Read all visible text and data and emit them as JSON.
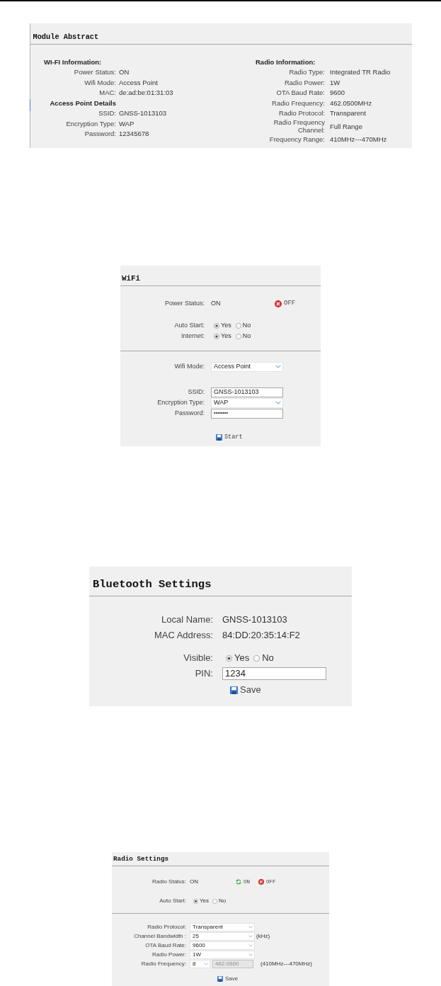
{
  "module_abstract": {
    "title": "Module Abstract",
    "columns": [
      {
        "items": [
          {
            "kind": "heading",
            "text": "WI-FI Information:"
          },
          {
            "kind": "field",
            "label": "Power Status:",
            "value": "ON"
          },
          {
            "kind": "field",
            "label": "Wifi Mode:",
            "value": "Access Point"
          },
          {
            "kind": "field",
            "label": "MAC:",
            "value": "de:ad:be:01:31:03"
          },
          {
            "kind": "subheading",
            "text": "Access Point Details"
          },
          {
            "kind": "field",
            "label": "SSID:",
            "value": "GNSS-1013103"
          },
          {
            "kind": "field",
            "label": "Encryption Type:",
            "value": "WAP"
          },
          {
            "kind": "field",
            "label": "Password:",
            "value": "12345678"
          }
        ]
      },
      {
        "items": [
          {
            "kind": "heading",
            "text": "Radio Information:"
          },
          {
            "kind": "field",
            "label": "Radio Type:",
            "value": "Integrated TR Radio"
          },
          {
            "kind": "field",
            "label": "Radio Power:",
            "value": "1W"
          },
          {
            "kind": "field",
            "label": "OTA Baud Rate:",
            "value": "9600"
          },
          {
            "kind": "field",
            "label": "Radio Frequency:",
            "value": "462.0500MHz"
          },
          {
            "kind": "field",
            "label": "Radio Protocol:",
            "value": "Transparent"
          },
          {
            "kind": "field",
            "label": "Radio Frequency Channel:",
            "value": "Full Range"
          },
          {
            "kind": "field",
            "label": "Frequency Range:",
            "value": "410MHz---470MHz"
          }
        ]
      }
    ]
  },
  "wifi": {
    "title": "WiFi",
    "sections": [
      {
        "groups": [
          [
            {
              "kind": "status",
              "label": "Power Status:",
              "value": "ON",
              "buttons": [
                {
                  "kind": "off",
                  "label": "OFF"
                }
              ]
            }
          ],
          [
            {
              "kind": "radio",
              "label": "Auto Start:",
              "options": [
                {
                  "label": "Yes",
                  "selected": true
                },
                {
                  "label": "No",
                  "selected": false
                }
              ]
            },
            {
              "kind": "radio",
              "label": "Internet:",
              "options": [
                {
                  "label": "Yes",
                  "selected": true
                },
                {
                  "label": "No",
                  "selected": false
                }
              ]
            }
          ]
        ]
      },
      {
        "groups": [
          [
            {
              "kind": "select",
              "label": "Wifi Mode:",
              "value": "Access Point"
            }
          ],
          [
            {
              "kind": "input",
              "label": "SSID:",
              "value": "GNSS-1013103"
            },
            {
              "kind": "select",
              "label": "Encryption Type:",
              "value": "WAP"
            },
            {
              "kind": "password",
              "label": "Password:",
              "value": "••••••••"
            }
          ]
        ]
      }
    ],
    "action": {
      "label": "Start"
    }
  },
  "bluetooth": {
    "title": "Bluetooth Settings",
    "sections": [
      {
        "groups": [
          [
            {
              "kind": "text",
              "label": "Local Name:",
              "value": "GNSS-1013103"
            },
            {
              "kind": "text",
              "label": "MAC Address:",
              "value": "84:DD:20:35:14:F2"
            }
          ],
          [
            {
              "kind": "radio",
              "label": "Visible:",
              "options": [
                {
                  "label": "Yes",
                  "selected": true
                },
                {
                  "label": "No",
                  "selected": false
                }
              ]
            },
            {
              "kind": "input",
              "label": "PIN:",
              "value": "1234"
            }
          ]
        ]
      }
    ],
    "action": {
      "label": "Save"
    }
  },
  "radio_settings": {
    "title": "Radio Settings",
    "sections": [
      {
        "groups": [
          [
            {
              "kind": "status",
              "label": "Radio Status:",
              "value": "ON",
              "buttons": [
                {
                  "kind": "on",
                  "label": "ON"
                },
                {
                  "kind": "off",
                  "label": "OFF"
                }
              ]
            }
          ],
          [
            {
              "kind": "radio",
              "label": "Auto Start:",
              "options": [
                {
                  "label": "Yes",
                  "selected": true
                },
                {
                  "label": "No",
                  "selected": false
                }
              ]
            }
          ]
        ]
      },
      {
        "groups": [
          [
            {
              "kind": "select",
              "label": "Radio Protocol:",
              "value": "Transparent"
            },
            {
              "kind": "select",
              "label": "Channel Bandwidth :",
              "value": "25",
              "unit": "(kHz)"
            },
            {
              "kind": "select",
              "label": "OTA Baud Rate:",
              "value": "9600"
            },
            {
              "kind": "select",
              "label": "Radio Power:",
              "value": "1W"
            },
            {
              "kind": "frequency",
              "label": "Radio Frequency:",
              "channel": "8",
              "value": "462.0500",
              "disabled": true,
              "unit": "(410MHz---470MHz)"
            }
          ]
        ]
      }
    ],
    "action": {
      "label": "Save"
    }
  }
}
